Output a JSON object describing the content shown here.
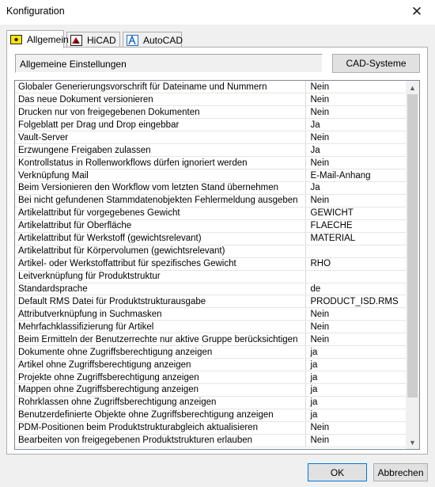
{
  "window": {
    "title": "Konfiguration",
    "close_glyph": "✕"
  },
  "tabs": [
    {
      "label": "Allgemein",
      "icon": "allgemein-icon",
      "active": true
    },
    {
      "label": "HiCAD",
      "icon": "hicad-icon",
      "active": false
    },
    {
      "label": "AutoCAD",
      "icon": "autocad-icon",
      "active": false
    }
  ],
  "group": {
    "label": "Allgemeine Einstellungen"
  },
  "buttons": {
    "cad": "CAD-Systeme",
    "ok": "OK",
    "cancel": "Abbrechen"
  },
  "rows": [
    {
      "name": "Globaler Generierungsvorschrift für Dateiname und Nummern",
      "value": "Nein"
    },
    {
      "name": "Das neue Dokument versionieren",
      "value": "Nein"
    },
    {
      "name": "Drucken nur von freigegebenen Dokumenten",
      "value": "Nein"
    },
    {
      "name": "Folgeblatt per Drag und Drop eingebbar",
      "value": "Ja"
    },
    {
      "name": "Vault-Server",
      "value": "Nein"
    },
    {
      "name": "Erzwungene Freigaben zulassen",
      "value": "Ja"
    },
    {
      "name": "Kontrollstatus in Rollenworkflows dürfen ignoriert werden",
      "value": "Nein"
    },
    {
      "name": "Verknüpfung Mail",
      "value": "E-Mail-Anhang"
    },
    {
      "name": "Beim Versionieren den Workflow vom letzten Stand übernehmen",
      "value": "Ja"
    },
    {
      "name": "Bei nicht gefundenen Stammdatenobjekten Fehlermeldung ausgeben",
      "value": "Nein"
    },
    {
      "name": "Artikelattribut für vorgegebenes Gewicht",
      "value": "GEWICHT"
    },
    {
      "name": "Artikelattribut für Oberfläche",
      "value": "FLAECHE"
    },
    {
      "name": "Artikelattribut für Werkstoff (gewichtsrelevant)",
      "value": "MATERIAL"
    },
    {
      "name": "Artikelattribut für Körpervolumen (gewichtsrelevant)",
      "value": ""
    },
    {
      "name": "Artikel- oder Werkstoffattribut für spezifisches Gewicht",
      "value": "RHO"
    },
    {
      "name": "Leitverknüpfung für Produktstruktur",
      "value": ""
    },
    {
      "name": "Standardsprache",
      "value": "de"
    },
    {
      "name": "Default RMS Datei für Produktstrukturausgabe",
      "value": "PRODUCT_ISD.RMS"
    },
    {
      "name": "Attributverknüpfung in Suchmasken",
      "value": "Nein"
    },
    {
      "name": "Mehrfachklassifizierung für Artikel",
      "value": "Nein"
    },
    {
      "name": "Beim Ermitteln der Benutzerrechte nur aktive Gruppe berücksichtigen",
      "value": "Nein"
    },
    {
      "name": "Dokumente ohne Zugriffsberechtigung anzeigen",
      "value": "ja"
    },
    {
      "name": "Artikel ohne Zugriffsberechtigung anzeigen",
      "value": "ja"
    },
    {
      "name": "Projekte ohne Zugriffsberechtigung anzeigen",
      "value": "ja"
    },
    {
      "name": "Mappen ohne Zugriffsberechtigung anzeigen",
      "value": "ja"
    },
    {
      "name": "Rohrklassen ohne Zugriffsberechtigung anzeigen",
      "value": "ja"
    },
    {
      "name": "Benutzerdefinierte Objekte ohne Zugriffsberechtigung anzeigen",
      "value": "ja"
    },
    {
      "name": "PDM-Positionen beim Produktstrukturabgleich aktualisieren",
      "value": "Nein"
    },
    {
      "name": "Bearbeiten von freigegebenen Produktstrukturen erlauben",
      "value": "Nein"
    }
  ]
}
